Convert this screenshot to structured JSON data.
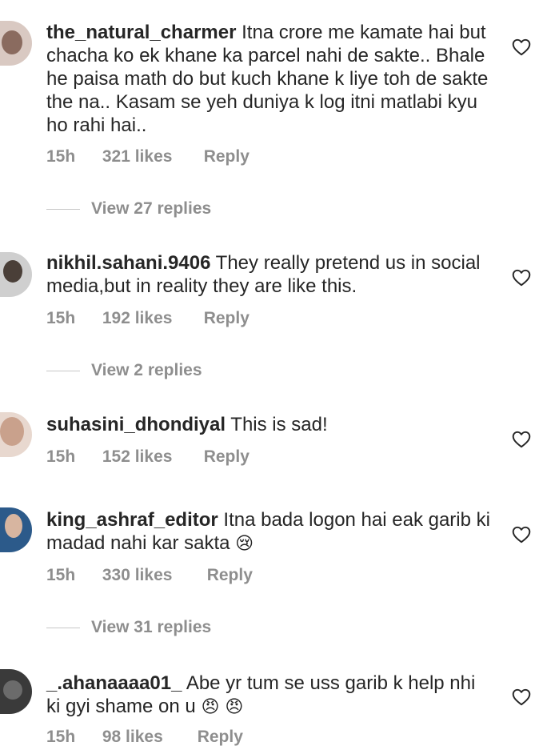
{
  "comments": [
    {
      "username": "the_natural_charmer",
      "text": " Itna crore me kamate hai but chacha ko ek khane ka parcel nahi de sakte.. Bhale he paisa math do but kuch khane k liye toh de sakte the na.. Kasam se yeh duniya k log itni matlabi kyu ho rahi hai..",
      "time": "15h",
      "likes": "321 likes",
      "reply_label": "Reply",
      "view_replies": "View 27 replies"
    },
    {
      "username": "nikhil.sahani.9406",
      "text": " They really pretend us in social media,but in reality they are like this.",
      "time": "15h",
      "likes": "192 likes",
      "reply_label": "Reply",
      "view_replies": "View 2 replies"
    },
    {
      "username": "suhasini_dhondiyal",
      "text": " This is sad!",
      "time": "15h",
      "likes": "152 likes",
      "reply_label": "Reply"
    },
    {
      "username": "king_ashraf_editor",
      "text": " Itna bada logon hai eak garib ki madad nahi kar sakta ",
      "emoji": "😢",
      "time": "15h",
      "likes": "330 likes",
      "reply_label": "Reply",
      "view_replies": "View 31 replies"
    },
    {
      "username": "_.ahanaaaa01_",
      "text": " Abe yr tum se uss garib k help nhi ki gyi shame on u",
      "emoji": "😠 😠",
      "time": "15h",
      "likes": "98 likes",
      "reply_label": "Reply"
    }
  ],
  "icons": {
    "like": "heart-outline-icon"
  },
  "colors": {
    "text": "#262626",
    "muted": "#8e8e8e",
    "divider": "#c7c7c7"
  }
}
